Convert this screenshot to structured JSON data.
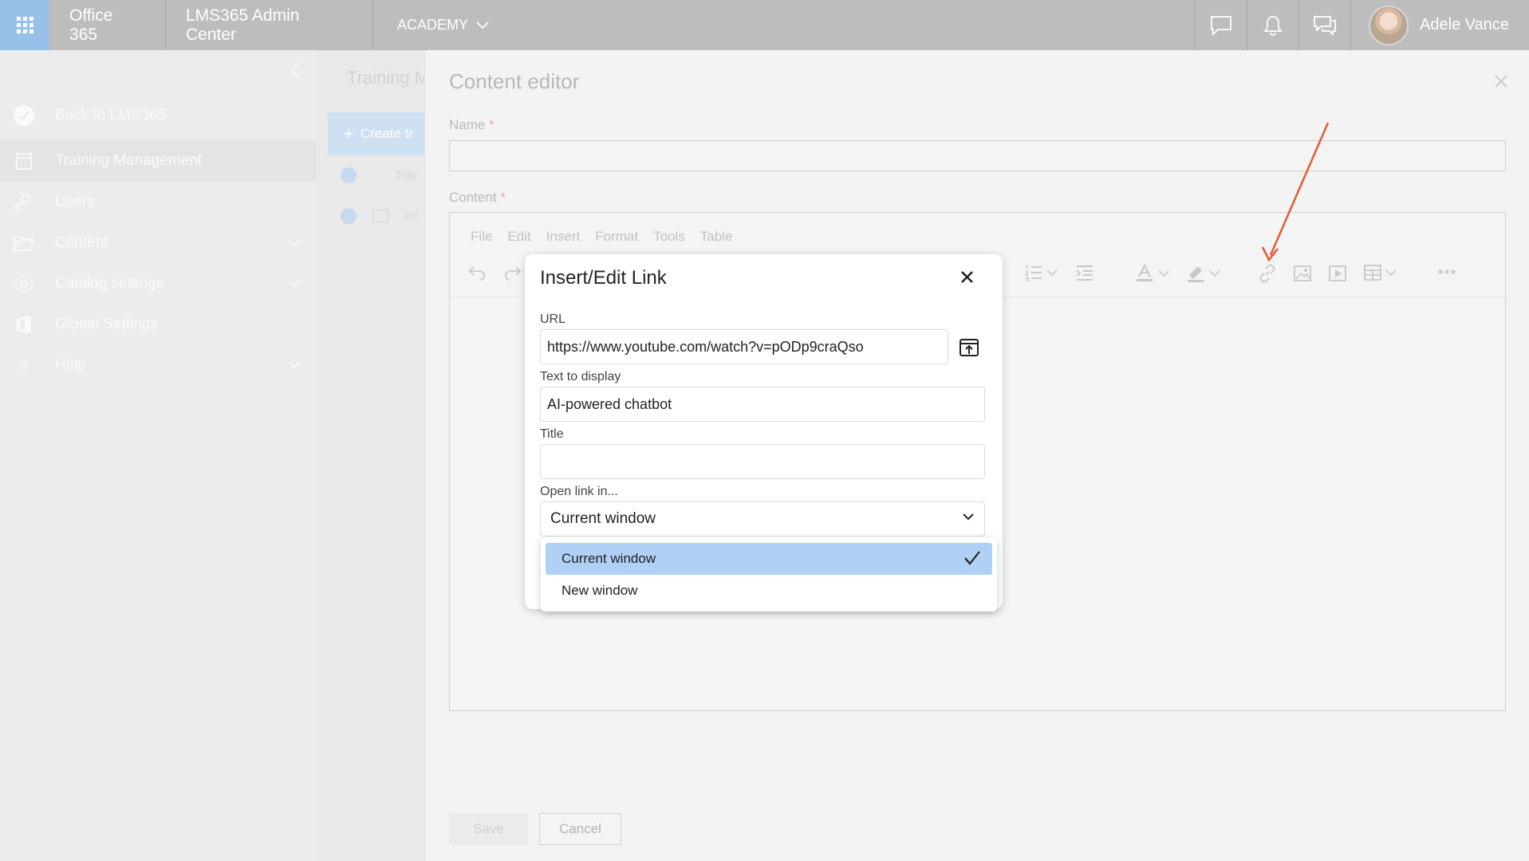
{
  "topbar": {
    "app_name": "Office 365",
    "admin_center": "LMS365 Admin Center",
    "academy": "ACADEMY",
    "user_name": "Adele Vance"
  },
  "leftnav": {
    "items": [
      {
        "label": "Back to LMS365",
        "icon": "check-circle-icon"
      },
      {
        "label": "Training Management",
        "icon": "calendar-icon"
      },
      {
        "label": "Users",
        "icon": "users-icon"
      },
      {
        "label": "Content",
        "icon": "folder-icon"
      },
      {
        "label": "Catalog settings",
        "icon": "gear-icon"
      },
      {
        "label": "Global Settings",
        "icon": "office-icon"
      },
      {
        "label": "Help",
        "icon": "question-icon"
      }
    ]
  },
  "middle": {
    "title": "Training M",
    "create_label": "Create tr",
    "row1": "Title",
    "row2": "Inf"
  },
  "editor": {
    "title": "Content editor",
    "name_label": "Name",
    "content_label": "Content",
    "required_mark": "*",
    "menu": [
      "File",
      "Edit",
      "Insert",
      "Format",
      "Tools",
      "Table"
    ],
    "save_label": "Save",
    "cancel_label": "Cancel"
  },
  "dialog": {
    "title": "Insert/Edit Link",
    "url_label": "URL",
    "url_value": "https://www.youtube.com/watch?v=pODp9craQso",
    "text_label": "Text to display",
    "text_value": "AI-powered chatbot",
    "title_label": "Title",
    "title_value": "",
    "open_label": "Open link in...",
    "open_value": "Current window",
    "options": [
      "Current window",
      "New window"
    ]
  },
  "colors": {
    "annotation_arrow": "#e0603a",
    "selected_option": "#b1d0f5"
  }
}
